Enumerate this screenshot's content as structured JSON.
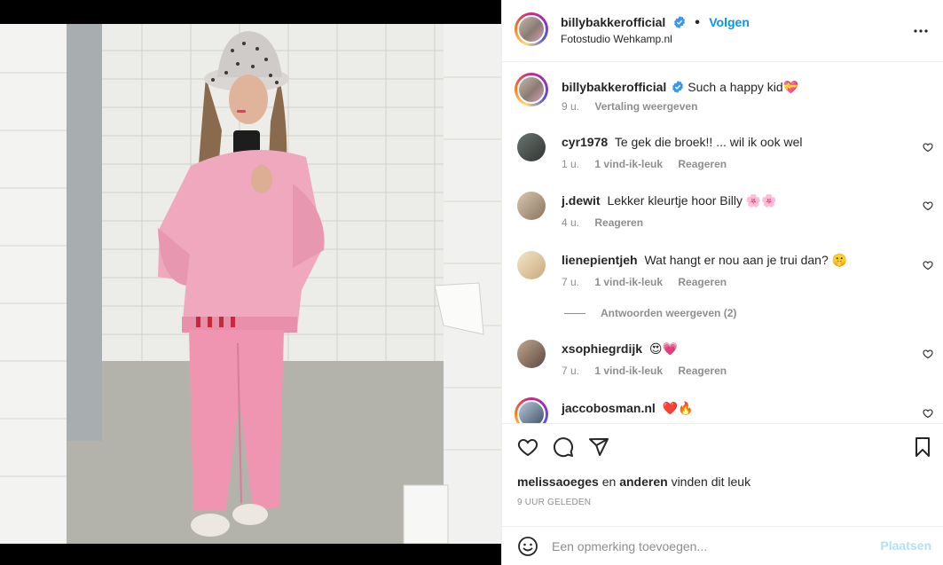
{
  "post": {
    "author": "billybakkerofficial",
    "location": "Fotostudio Wehkamp.nl",
    "follow_label": "Volgen",
    "separator": "•"
  },
  "caption": {
    "username": "billybakkerofficial",
    "text": "Such a happy kid💝",
    "time": "9 u.",
    "translate_label": "Vertaling weergeven"
  },
  "comments": [
    {
      "username": "cyr1978",
      "text": "Te gek die broek!! ... wil ik ook wel",
      "time": "1 u.",
      "likes": "1 vind-ik-leuk",
      "reply": "Reageren"
    },
    {
      "username": "j.dewit",
      "text": "Lekker kleurtje hoor Billy 🌸🌸",
      "time": "4 u.",
      "likes": "",
      "reply": "Reageren"
    },
    {
      "username": "lienepientjeh",
      "text": "Wat hangt er nou aan je trui dan? 🤫",
      "time": "7 u.",
      "likes": "1 vind-ik-leuk",
      "reply": "Reageren",
      "view_replies": "Antwoorden weergeven (2)"
    },
    {
      "username": "xsophiegrdijk",
      "text": "😍💗",
      "time": "7 u.",
      "likes": "1 vind-ik-leuk",
      "reply": "Reageren"
    },
    {
      "username": "jaccobosman.nl",
      "text": "❤️🔥",
      "time": "",
      "likes": "",
      "reply": ""
    }
  ],
  "likes_summary": {
    "first_user": "melissaoeges",
    "connector": "en",
    "others": "anderen",
    "suffix": "vinden dit leuk"
  },
  "posted_ago": "9 UUR GELEDEN",
  "comment_box": {
    "placeholder": "Een opmerking toevoegen...",
    "post_label": "Plaatsen"
  },
  "colors": {
    "accent": "#0095f6",
    "post_button_disabled": "#b2dffc",
    "muted": "#8e8e8e",
    "text": "#262626",
    "verified": "#3897f0"
  },
  "icons": [
    "verified-badge-icon",
    "more-options-icon",
    "heart-icon",
    "comment-icon",
    "share-icon",
    "bookmark-icon",
    "emoji-icon"
  ]
}
